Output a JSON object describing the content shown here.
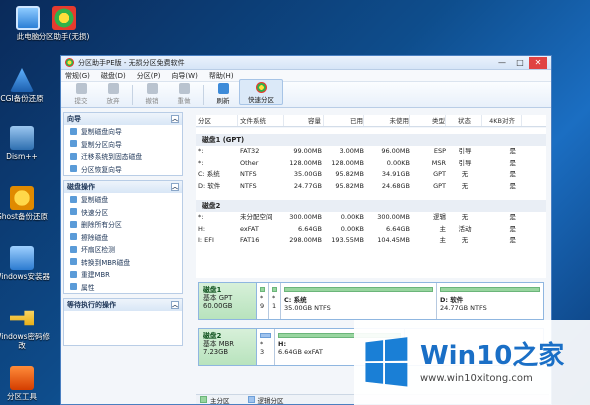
{
  "desktop": {
    "icons": [
      {
        "label": "此电脑",
        "icon": "computer-icon"
      },
      {
        "label": "分区助手(无损)",
        "icon": "partition-assistant-icon"
      },
      {
        "label": "CGI备份还原",
        "icon": "cgi-backup-icon"
      },
      {
        "label": "Dism++",
        "icon": "dism-icon"
      },
      {
        "label": "Ghost备份还原",
        "icon": "ghost-icon"
      },
      {
        "label": "Windows安装器",
        "icon": "windows-installer-icon"
      },
      {
        "label": "Windows密码修改",
        "icon": "key-icon"
      },
      {
        "label": "分区工具",
        "icon": "partition-tool-icon"
      }
    ]
  },
  "window": {
    "title": "分区助手PE版 - 无损分区免费软件",
    "controls": {
      "minimize": "—",
      "maximize": "□",
      "close": "✕"
    }
  },
  "menu": [
    "常规(G)",
    "磁盘(D)",
    "分区(P)",
    "向导(W)",
    "帮助(H)"
  ],
  "toolbar": {
    "commit": "提交",
    "discard": "放弃",
    "undo": "撤销",
    "redo": "重做",
    "refresh": "刷新",
    "quick_partition": "快速分区"
  },
  "wizard_panel": {
    "title": "向导",
    "items": [
      "复制磁盘向导",
      "复制分区向导",
      "迁移系统到固态磁盘",
      "分区恢复向导"
    ]
  },
  "disk_ops_panel": {
    "title": "磁盘操作",
    "items": [
      "复制磁盘",
      "快速分区",
      "删除所有分区",
      "擦除磁盘",
      "坏扇区检测",
      "转换到MBR磁盘",
      "重建MBR",
      "属性"
    ]
  },
  "pending_panel": {
    "title": "等待执行的操作"
  },
  "grid": {
    "headers": [
      "分区",
      "文件系统",
      "容量",
      "已用",
      "未使用",
      "类型",
      "状态",
      "4KB对齐"
    ],
    "disks": [
      {
        "label": "磁盘1 (GPT)",
        "rows": [
          [
            "*:",
            "FAT32",
            "99.00MB",
            "3.00MB",
            "96.00MB",
            "ESP",
            "引导",
            "是"
          ],
          [
            "*:",
            "Other",
            "128.00MB",
            "128.00MB",
            "0.00KB",
            "MSR",
            "引导",
            "是"
          ],
          [
            "C: 系统",
            "NTFS",
            "35.00GB",
            "95.82MB",
            "34.91GB",
            "GPT",
            "无",
            "是"
          ],
          [
            "D: 软件",
            "NTFS",
            "24.77GB",
            "95.82MB",
            "24.68GB",
            "GPT",
            "无",
            "是"
          ]
        ]
      },
      {
        "label": "磁盘2",
        "rows": [
          [
            "*:",
            "未分配空间",
            "300.00MB",
            "0.00KB",
            "300.00MB",
            "逻辑",
            "无",
            "是"
          ],
          [
            "H:",
            "exFAT",
            "6.64GB",
            "0.00KB",
            "6.64GB",
            "主",
            "活动",
            "是"
          ],
          [
            "I: EFI",
            "FAT16",
            "298.00MB",
            "193.55MB",
            "104.45MB",
            "主",
            "无",
            "是"
          ]
        ]
      }
    ]
  },
  "diskmap": {
    "disk1": {
      "name": "磁盘1",
      "type": "基本 GPT",
      "size": "60.00GB",
      "blocks": [
        {
          "label": "*",
          "detail": "9"
        },
        {
          "label": "*",
          "detail": "1"
        },
        {
          "label": "C: 系统",
          "detail": "35.00GB NTFS"
        },
        {
          "label": "D: 软件",
          "detail": "24.77GB NTFS"
        }
      ]
    },
    "disk2": {
      "name": "磁盘2",
      "type": "基本 MBR",
      "size": "7.23GB",
      "blocks": [
        {
          "label": "*",
          "detail": "3"
        },
        {
          "label": "H:",
          "detail": "6.64GB exFAT"
        }
      ]
    },
    "legend": {
      "primary": "主分区",
      "logical": "逻辑分区"
    }
  },
  "watermark": {
    "brand": "Win10",
    "suffix": "之家",
    "url": "www.win10xitong.com"
  },
  "colors": {
    "primary": "#98d59f",
    "logical": "#9fc3ee",
    "accent": "#1a7fd6"
  }
}
